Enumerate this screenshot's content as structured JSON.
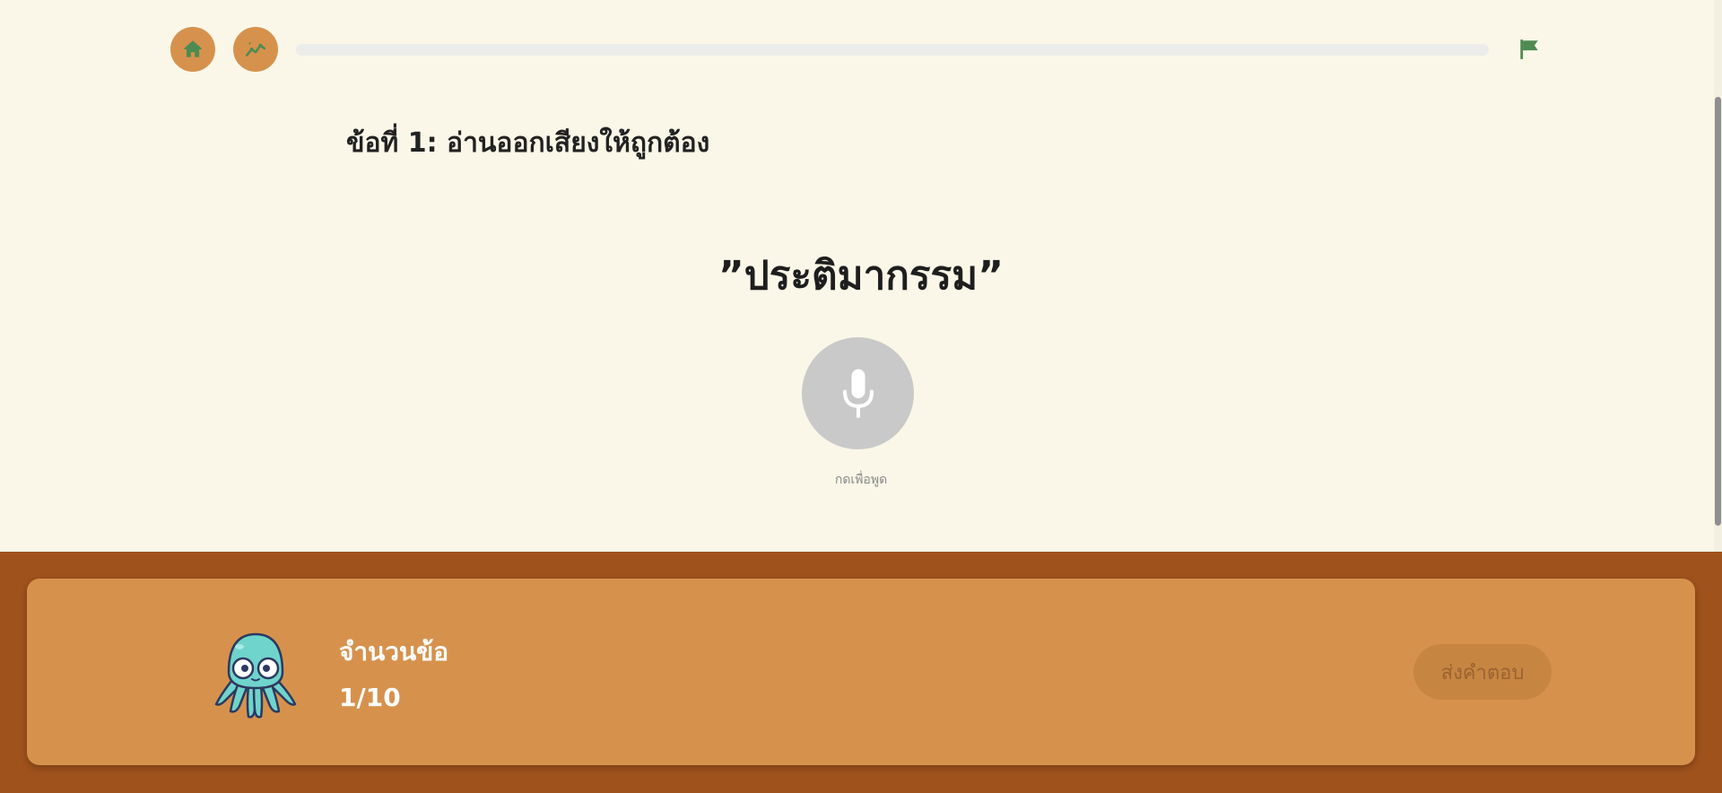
{
  "header": {
    "home_icon": "home-icon",
    "stats_icon": "stats-chart-icon",
    "progress": 0.0,
    "flag_icon": "flag-icon"
  },
  "question": {
    "title": "ข้อที่ 1: อ่านออกเสียงให้ถูกต้อง",
    "word": "”ประติมากรรม”",
    "mic_icon": "microphone-icon",
    "mic_hint": "กดเพื่อพูด"
  },
  "footer": {
    "count_label": "จำนวนข้อ",
    "count_value": "1/10",
    "submit_label": "ส่งคำตอบ",
    "mascot": "octopus-mascot"
  },
  "colors": {
    "background": "#faf7e8",
    "accent": "#d6924d",
    "footer_bg": "#a0521c",
    "icon_green": "#4e8b52",
    "mic_disabled": "#c9c9c9"
  }
}
